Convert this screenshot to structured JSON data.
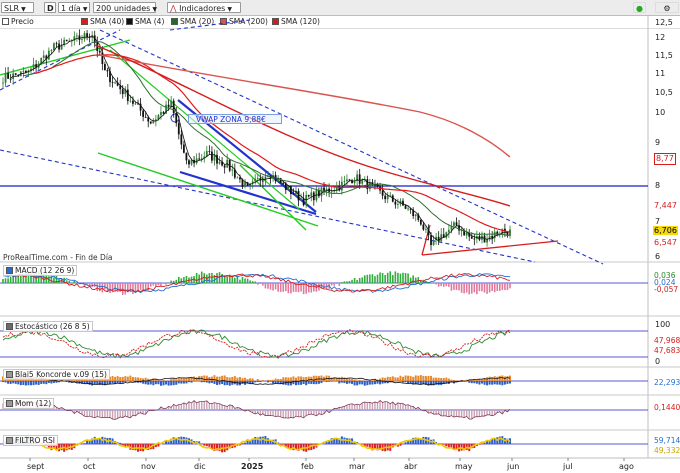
{
  "toolbar": {
    "symbol": "SLR",
    "period_icon": "D",
    "period": "1 día",
    "units": "200 unidades",
    "indicators": "Indicadores"
  },
  "legend": {
    "items": [
      {
        "label": "Precio",
        "color": "#2f8a2f"
      },
      {
        "label": "SMA (40)",
        "color": "#e01a1a"
      },
      {
        "label": "SMA (4)",
        "color": "#111111"
      },
      {
        "label": "SMA (20)",
        "color": "#1f6e1f"
      },
      {
        "label": "SMA (200)",
        "color": "#d9534f"
      },
      {
        "label": "SMA (120)",
        "color": "#d61d1d"
      }
    ]
  },
  "watermark": "ProRealTime.com - Fin de Día",
  "annotation": "VWAP ZONA 9,88€",
  "colors": {
    "up": "#2e7d32",
    "down": "#111111",
    "sma40": "#e01a1a",
    "sma20": "#2f6f2f",
    "sma200": "#d9534f",
    "sma120": "#d61d1d",
    "channel": "#2233cc",
    "wedge": "#2233cc",
    "green_lines": "#22cc22",
    "level8": "#1a1acc"
  },
  "price_axis": {
    "ticks": [
      "12,5",
      "12",
      "11,5",
      "11",
      "10,5",
      "10",
      "9",
      "8",
      "7",
      "6"
    ],
    "labels": {
      "p877": "8,77",
      "p7447": "7,447",
      "p6706": "6,706",
      "p6547": "6,547"
    }
  },
  "time_axis": {
    "labels": [
      "sept",
      "oct",
      "nov",
      "dic",
      "2025",
      "feb",
      "mar",
      "abr",
      "may",
      "jun",
      "jul",
      "ago"
    ]
  },
  "panels": {
    "macd": {
      "title": "MACD (12 26 9)",
      "labels": [
        "0,036",
        "0,024",
        "-0,057"
      ]
    },
    "stoch": {
      "title": "Estocástico (26 8 5)",
      "labels": [
        "100",
        "47,968",
        "47,683",
        "0"
      ]
    },
    "blai5": {
      "title": "Blai5 Koncorde v.09 (15)",
      "labels": [
        "22,293"
      ]
    },
    "mom": {
      "title": "Mom (12)",
      "labels": [
        "0,1440"
      ]
    },
    "filtro": {
      "title": "FILTRO RSI",
      "labels": [
        "59,714",
        "49,332"
      ]
    }
  },
  "chart_data": {
    "type": "candlestick",
    "instrument": "SLR",
    "timeframe": "1 día",
    "bars": 200,
    "price_series": {
      "months": [
        "sept",
        "oct",
        "nov",
        "dic",
        "2025",
        "feb",
        "mar",
        "abr",
        "may"
      ],
      "approx_close_by_month_start": [
        11.3,
        12.0,
        10.0,
        8.8,
        7.9,
        7.8,
        8.2,
        6.6,
        6.7
      ],
      "last_close": 6.706
    },
    "moving_averages": {
      "SMA (200)": 8.77,
      "SMA (120)": 7.447,
      "SMA (40)": 6.547,
      "SMA (20)": 6.706
    },
    "horizontal_levels": [
      8.0
    ],
    "annotations": [
      "VWAP ZONA 9,88€"
    ],
    "yticks": [
      12.5,
      12,
      11.5,
      11,
      10.5,
      10,
      9,
      8,
      7,
      6
    ],
    "xlabels": [
      "sept",
      "oct",
      "nov",
      "dic",
      "2025",
      "feb",
      "mar",
      "abr",
      "may",
      "jun",
      "jul",
      "ago"
    ],
    "indicators": [
      {
        "name": "MACD (12 26 9)",
        "last": [
          0.036,
          0.024,
          -0.057
        ]
      },
      {
        "name": "Estocástico (26 8 5)",
        "last": [
          47.968,
          47.683
        ]
      },
      {
        "name": "Blai5 Koncorde v.09 (15)",
        "last": 22.293
      },
      {
        "name": "Mom (12)",
        "last": 0.144
      },
      {
        "name": "FILTRO RSI",
        "last": [
          59.714,
          49.332
        ]
      }
    ]
  }
}
